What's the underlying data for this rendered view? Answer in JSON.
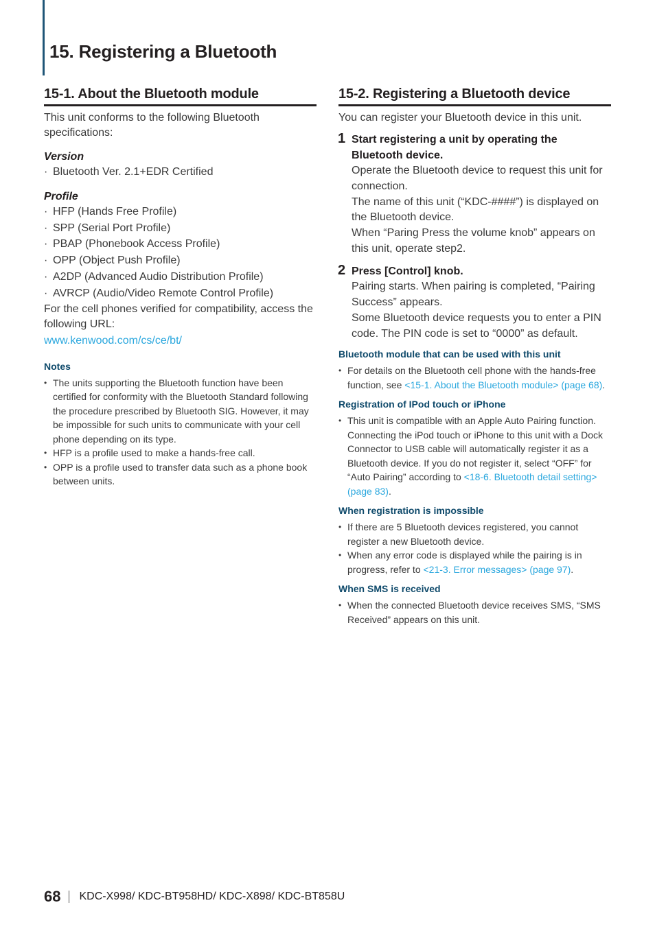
{
  "chapter": {
    "title": "15.  Registering a Bluetooth"
  },
  "left": {
    "section_title": "15-1.  About the Bluetooth module",
    "intro": "This unit conforms to the following Bluetooth specifications:",
    "version_heading": "Version",
    "version_items": [
      "Bluetooth Ver. 2.1+EDR Certified"
    ],
    "profile_heading": "Profile",
    "profile_items": [
      "HFP (Hands Free Profile)",
      "SPP (Serial Port Profile)",
      "PBAP (Phonebook Access Profile)",
      "OPP (Object Push Profile)",
      "A2DP (Advanced Audio Distribution Profile)",
      "AVRCP (Audio/Video Remote Control Profile)"
    ],
    "compat_text": "For the cell phones verified for compatibility, access the following URL:",
    "url": "www.kenwood.com/cs/ce/bt/",
    "notes_heading": "Notes",
    "notes": [
      "The units supporting the Bluetooth function have been certified for conformity with the Bluetooth Standard following the procedure prescribed by Bluetooth SIG. However, it may be impossible for such units to communicate with your cell phone depending on its type.",
      "HFP is a profile used to make a hands-free call.",
      "OPP is a profile used to transfer data such as a phone book between units."
    ]
  },
  "right": {
    "section_title": "15-2.  Registering a Bluetooth device",
    "intro": "You can register your Bluetooth device in this unit.",
    "steps": [
      {
        "num": "1",
        "title": "Start registering a unit by operating the Bluetooth device.",
        "lines": [
          "Operate the Bluetooth device to request this unit for connection.",
          "The name of this unit (“KDC-####”) is displayed on the Bluetooth device.",
          "When “Paring Press the volume knob” appears on this unit, operate step2."
        ]
      },
      {
        "num": "2",
        "title": "Press [Control] knob.",
        "lines": [
          "Pairing starts. When pairing is completed, “Pairing Success” appears.",
          "Some Bluetooth device requests you to enter a PIN code. The PIN code is set to “0000” as default."
        ]
      }
    ],
    "module_heading": "Bluetooth module that can be used with this unit",
    "module_item_text": "For details on the Bluetooth cell phone with the hands-free function, see ",
    "module_item_link": "<15-1. About the Bluetooth module> (page 68)",
    "ipod_heading": "Registration of IPod touch or iPhone",
    "ipod_item_text": "This unit is compatible with an Apple Auto Pairing function. Connecting the iPod touch or iPhone to this unit with a Dock Connector to USB cable will automatically register it as a Bluetooth device. If you do not register it, select “OFF” for “Auto Pairing” according to ",
    "ipod_item_link": "<18-6. Bluetooth detail setting> (page 83)",
    "impossible_heading": "When registration is impossible",
    "impossible_item1": "If there are 5 Bluetooth devices registered, you cannot register a new Bluetooth device.",
    "impossible_item2_text": "When any error code is displayed while the pairing is in progress, refer to ",
    "impossible_item2_link": "<21-3. Error messages> (page 97)",
    "sms_heading": "When SMS is received",
    "sms_item": "When the connected Bluetooth device receives SMS, “SMS Received” appears on this unit."
  },
  "footer": {
    "page_number": "68",
    "models": "KDC-X998/ KDC-BT958HD/ KDC-X898/ KDC-BT858U"
  },
  "colors": {
    "accent": "#1f5577",
    "link": "#2aa7de",
    "subheading": "#0f4a6b"
  }
}
